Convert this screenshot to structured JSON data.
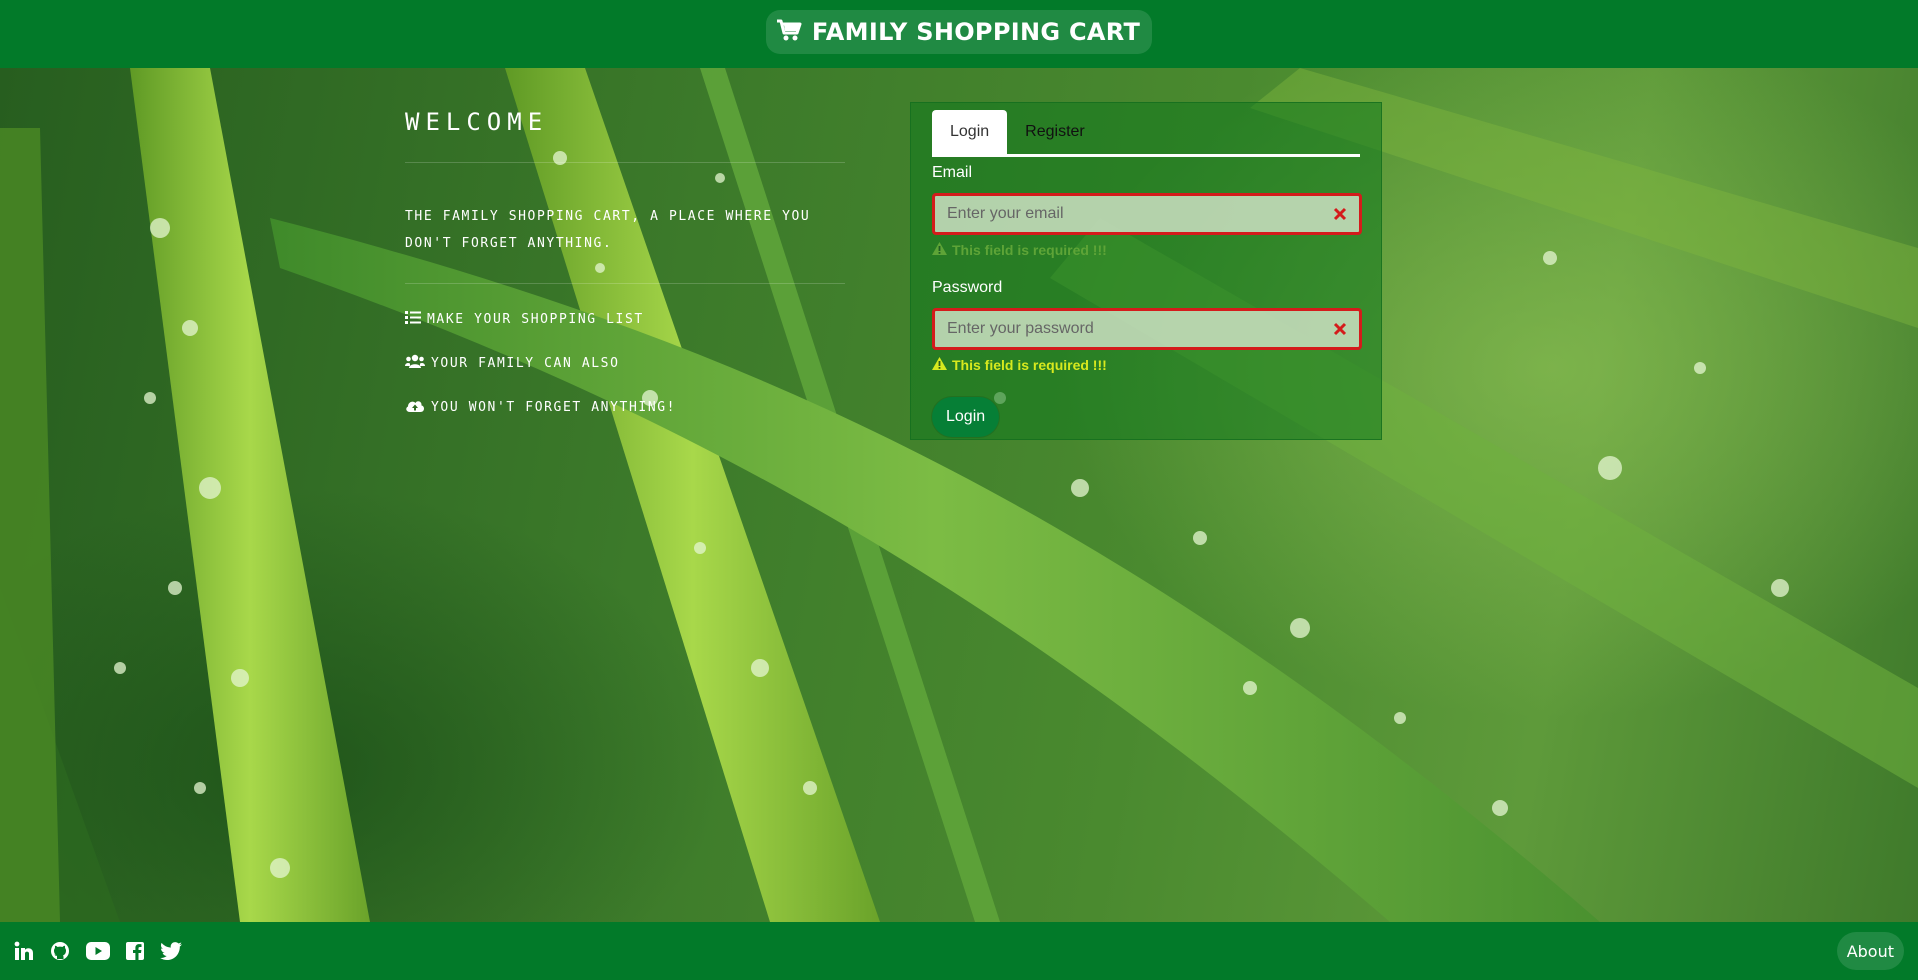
{
  "header": {
    "app_title": "Family Shopping Cart",
    "icon": "shopping-cart-icon"
  },
  "intro": {
    "title": "Welcome",
    "description": "The family shopping cart, a place where you don't forget anything.",
    "features": [
      {
        "icon": "list-icon",
        "label": "Make your shopping list"
      },
      {
        "icon": "users-icon",
        "label": "Your family can also"
      },
      {
        "icon": "cloud-upload-icon",
        "label": "You won't forget anything!"
      }
    ]
  },
  "auth": {
    "tabs": [
      {
        "label": "Login",
        "active": true
      },
      {
        "label": "Register",
        "active": false
      }
    ],
    "email": {
      "label": "Email",
      "placeholder": "Enter your email",
      "value": "",
      "error": "This field is required !!!"
    },
    "password": {
      "label": "Password",
      "placeholder": "Enter your password",
      "value": "",
      "error": "This field is required !!!"
    },
    "submit_label": "Login"
  },
  "footer": {
    "socials": [
      "linkedin-icon",
      "github-icon",
      "youtube-icon",
      "facebook-icon",
      "twitter-icon"
    ],
    "about_label": "About"
  },
  "colors": {
    "brand_green": "#027a29",
    "error_red": "#d41b1b",
    "error_text": "#d7e91e"
  }
}
